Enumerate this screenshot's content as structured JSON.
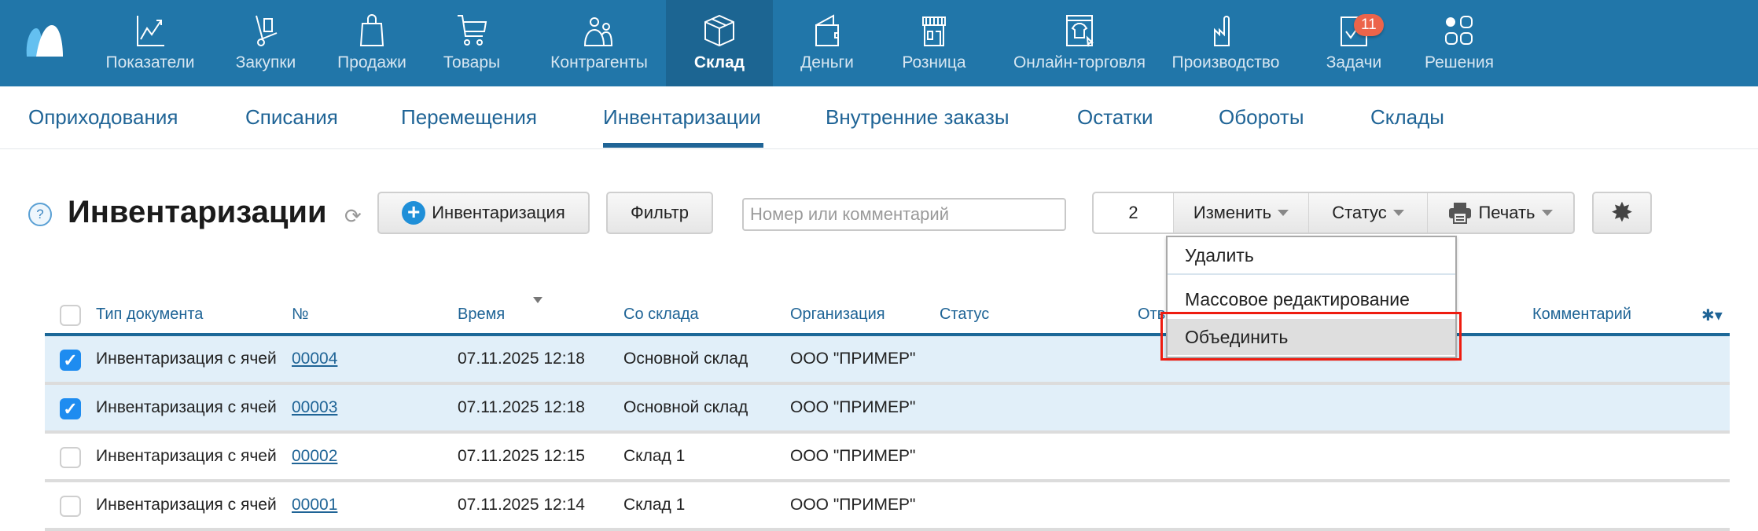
{
  "top_nav": {
    "items": [
      {
        "label": "Показатели",
        "icon": "chart-line-icon"
      },
      {
        "label": "Закупки",
        "icon": "hand-truck-icon"
      },
      {
        "label": "Продажи",
        "icon": "shopping-bag-icon"
      },
      {
        "label": "Товары",
        "icon": "cart-icon"
      },
      {
        "label": "Контрагенты",
        "icon": "people-icon"
      },
      {
        "label": "Склад",
        "icon": "box-icon",
        "active": true
      },
      {
        "label": "Деньги",
        "icon": "wallet-icon"
      },
      {
        "label": "Розница",
        "icon": "store-icon"
      },
      {
        "label": "Онлайн-торговля",
        "icon": "online-store-icon"
      },
      {
        "label": "Производство",
        "icon": "factory-icon"
      },
      {
        "label": "Задачи",
        "icon": "tasks-icon",
        "badge": "11"
      },
      {
        "label": "Решения",
        "icon": "apps-icon"
      }
    ]
  },
  "sub_nav": {
    "items": [
      "Оприходования",
      "Списания",
      "Перемещения",
      "Инвентаризации",
      "Внутренние заказы",
      "Остатки",
      "Обороты",
      "Склады"
    ],
    "active": "Инвентаризации"
  },
  "toolbar": {
    "help": "?",
    "title": "Инвентаризации",
    "add_label": "Инвентаризация",
    "filter_label": "Фильтр",
    "search_placeholder": "Номер или комментарий",
    "search_value": "",
    "selected_count": "2",
    "change_label": "Изменить",
    "status_label": "Статус",
    "print_label": "Печать"
  },
  "change_menu": {
    "items": [
      "Удалить",
      "Массовое редактирование",
      "Объединить"
    ],
    "highlighted": "Объединить"
  },
  "table": {
    "columns": [
      "Тип документа",
      "№",
      "Время",
      "Со склада",
      "Организация",
      "Статус",
      "Ответственный",
      "Комментарий"
    ],
    "sorted_by": "Время",
    "rows": [
      {
        "checked": true,
        "type": "Инвентаризация с ячей",
        "number": "00004",
        "time": "07.11.2025 12:18",
        "warehouse": "Основной склад",
        "org": "ООО \"ПРИМЕР\""
      },
      {
        "checked": true,
        "type": "Инвентаризация с ячей",
        "number": "00003",
        "time": "07.11.2025 12:18",
        "warehouse": "Основной склад",
        "org": "ООО \"ПРИМЕР\""
      },
      {
        "checked": false,
        "type": "Инвентаризация с ячей",
        "number": "00002",
        "time": "07.11.2025 12:15",
        "warehouse": "Склад 1",
        "org": "ООО \"ПРИМЕР\""
      },
      {
        "checked": false,
        "type": "Инвентаризация с ячей",
        "number": "00001",
        "time": "07.11.2025 12:14",
        "warehouse": "Склад 1",
        "org": "ООО \"ПРИМЕР\""
      }
    ]
  },
  "colors": {
    "nav_bg": "#2176a9",
    "nav_active": "#1c6592",
    "link": "#1f6496",
    "selected_row": "#e1eff9",
    "badge": "#ec644a",
    "highlight_box": "#ee1c10"
  }
}
